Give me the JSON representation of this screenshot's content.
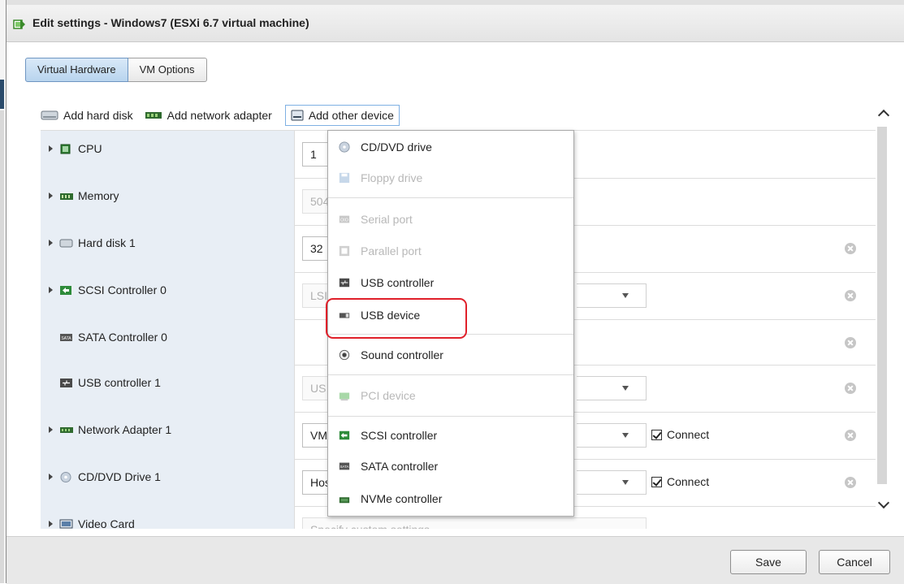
{
  "window": {
    "title": "Edit settings - Windows7 (ESXi 6.7 virtual machine)"
  },
  "tabs": [
    {
      "label": "Virtual Hardware",
      "active": true
    },
    {
      "label": "VM Options",
      "active": false
    }
  ],
  "toolbar": {
    "add_hard_disk": "Add hard disk",
    "add_network_adapter": "Add network adapter",
    "add_other_device": "Add other device"
  },
  "hardware": [
    {
      "label": "CPU",
      "icon": "cpu-icon",
      "expandable": true,
      "value": "1"
    },
    {
      "label": "Memory",
      "icon": "memory-icon",
      "expandable": true,
      "value": "504"
    },
    {
      "label": "Hard disk 1",
      "icon": "hard-disk-icon",
      "expandable": true,
      "value": "32"
    },
    {
      "label": "SCSI Controller 0",
      "icon": "scsi-icon",
      "expandable": true,
      "value": "LSI"
    },
    {
      "label": "SATA Controller 0",
      "icon": "sata-icon",
      "expandable": false,
      "value": ""
    },
    {
      "label": "USB controller 1",
      "icon": "usb-icon",
      "expandable": false,
      "value": "US"
    },
    {
      "label": "Network Adapter 1",
      "icon": "network-icon",
      "expandable": true,
      "value": "VM",
      "connect": "Connect"
    },
    {
      "label": "CD/DVD Drive 1",
      "icon": "cd-icon",
      "expandable": true,
      "value": "Hos",
      "connect": "Connect"
    },
    {
      "label": "Video Card",
      "icon": "video-card-icon",
      "expandable": true,
      "value": "Specify custom settings"
    }
  ],
  "menu": {
    "items": [
      {
        "label": "CD/DVD drive",
        "enabled": true,
        "icon": "cd-dvd-icon"
      },
      {
        "label": "Floppy drive",
        "enabled": false,
        "icon": "floppy-icon"
      },
      {
        "label": "Serial port",
        "enabled": false,
        "icon": "serial-port-icon"
      },
      {
        "label": "Parallel port",
        "enabled": false,
        "icon": "parallel-port-icon"
      },
      {
        "label": "USB controller",
        "enabled": true,
        "icon": "usb-controller-icon"
      },
      {
        "label": "USB device",
        "enabled": true,
        "icon": "usb-device-icon"
      },
      {
        "label": "Sound controller",
        "enabled": true,
        "icon": "sound-icon"
      },
      {
        "label": "PCI device",
        "enabled": false,
        "icon": "pci-icon"
      },
      {
        "label": "SCSI controller",
        "enabled": true,
        "icon": "scsi-controller-icon"
      },
      {
        "label": "SATA controller",
        "enabled": true,
        "icon": "sata-controller-icon"
      },
      {
        "label": "NVMe controller",
        "enabled": true,
        "icon": "nvme-controller-icon"
      }
    ]
  },
  "footer": {
    "save": "Save",
    "cancel": "Cancel"
  },
  "colors": {
    "highlight": "#e0202a",
    "tab_active": "#b8d4ee",
    "label_bg": "#e8eef5"
  }
}
